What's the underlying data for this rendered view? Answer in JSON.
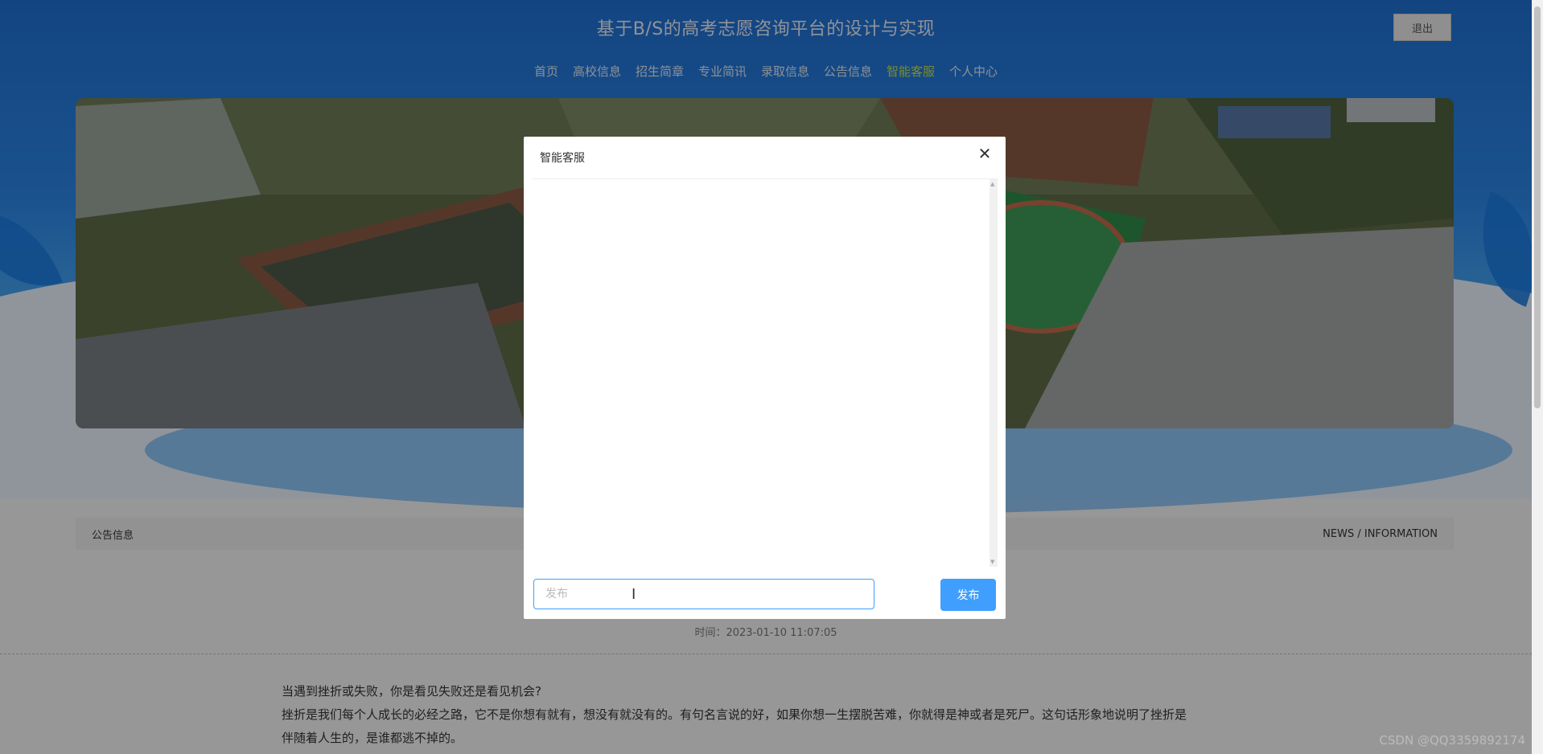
{
  "header": {
    "title": "基于B/S的高考志愿咨询平台的设计与实现",
    "logout_label": "退出"
  },
  "nav": {
    "items": [
      {
        "label": "首页"
      },
      {
        "label": "高校信息"
      },
      {
        "label": "招生简章"
      },
      {
        "label": "专业简讯"
      },
      {
        "label": "录取信息"
      },
      {
        "label": "公告信息"
      },
      {
        "label": "智能客服",
        "active": true
      },
      {
        "label": "个人中心"
      }
    ]
  },
  "notice_bar": {
    "left": "公告信息",
    "right": "NEWS / INFORMATION"
  },
  "article": {
    "time": "时间：2023-01-10 11:07:05",
    "paragraph1": "当遇到挫折或失败，你是看见失败还是看见机会?",
    "paragraph2": "挫折是我们每个人成长的必经之路，它不是你想有就有，想没有就没有的。有句名言说的好，如果你想一生摆脱苦难，你就得是神或者是死尸。这句话形象地说明了挫折是",
    "paragraph3": "伴随着人生的，是谁都逃不掉的。"
  },
  "modal": {
    "title": "智能客服",
    "input_placeholder": "发布",
    "input_value": "",
    "send_label": "发布"
  },
  "watermark": "CSDN @QQ3359892174",
  "colors": {
    "accent": "#409eff",
    "nav_active": "#c8e04a"
  }
}
